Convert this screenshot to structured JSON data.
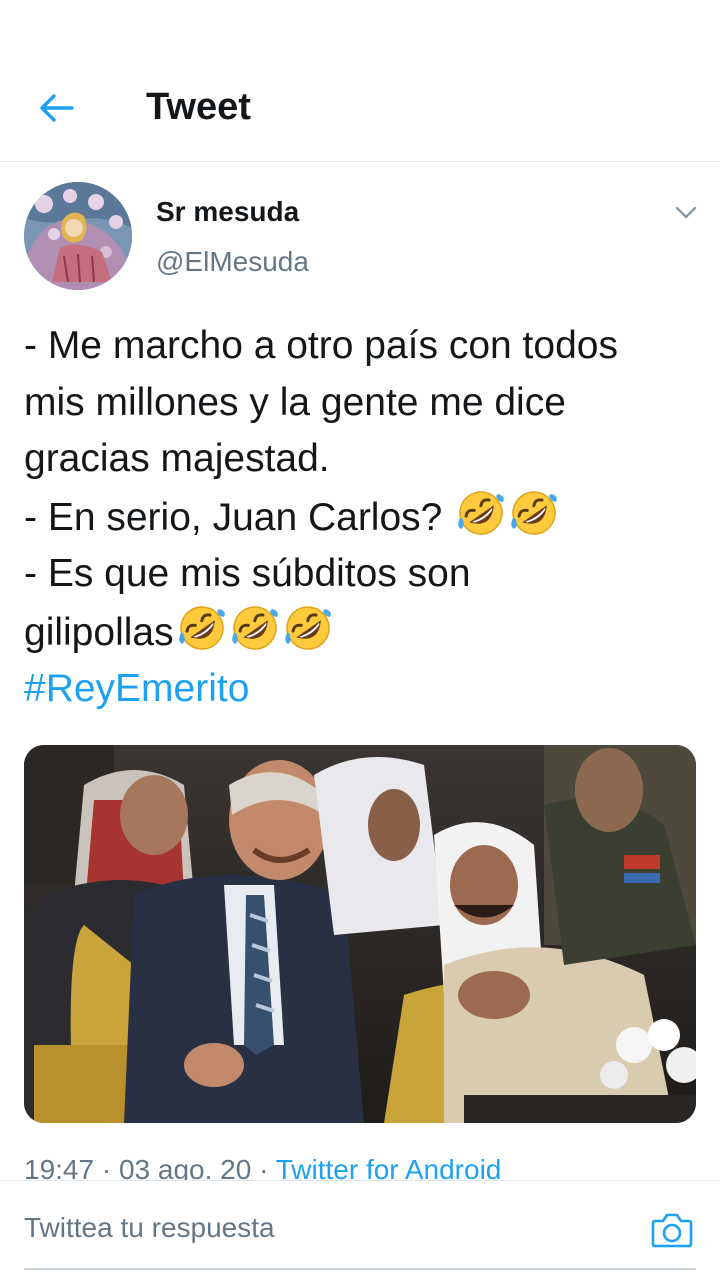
{
  "header": {
    "back_icon": "arrow-left-icon",
    "title": "Tweet"
  },
  "tweet": {
    "author": {
      "display_name": "Sr mesuda",
      "handle": "@ElMesuda"
    },
    "menu_icon": "chevron-down-icon",
    "lines": [
      "- Me marcho a otro país con todos",
      "mis millones y la gente me dice",
      "gracias majestad.",
      "- En serio, Juan Carlos? ",
      "- Es que mis súbditos son",
      "gilipollas"
    ],
    "hashtag": "#ReyEmerito",
    "emoji_name": "rolling-on-the-floor-laughing",
    "line4_emoji_count": 2,
    "line6_emoji_count": 3,
    "meta": {
      "time": "19:47",
      "date": "03 ago. 20",
      "separator": " · ",
      "source": "Twitter for Android"
    }
  },
  "reply": {
    "placeholder": "Twittea tu respuesta",
    "camera_icon": "camera-icon"
  },
  "colors": {
    "accent": "#1da1f2",
    "text": "#14171a",
    "secondary": "#657786",
    "divider": "#e1e8ed"
  }
}
